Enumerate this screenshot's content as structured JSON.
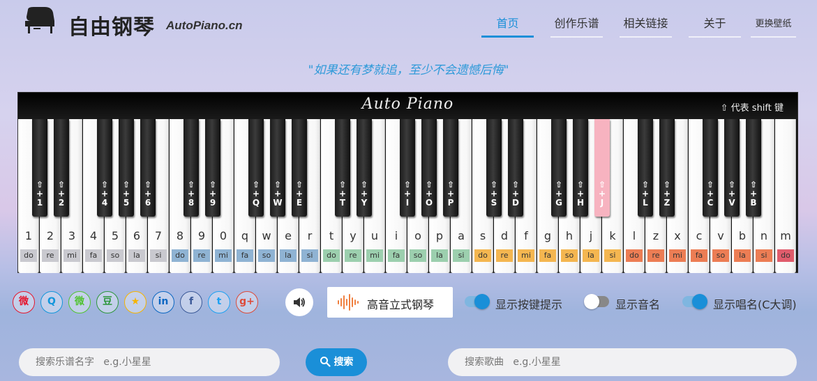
{
  "header": {
    "site_name": "自由钢琴",
    "site_domain": "AutoPiano.cn",
    "nav": [
      {
        "label": "首页"
      },
      {
        "label": "创作乐谱"
      },
      {
        "label": "相关链接"
      },
      {
        "label": "关于"
      },
      {
        "label": "更换壁纸"
      }
    ]
  },
  "slogan": "\"如果还有梦就追，至少不会遗憾后悔\"",
  "piano": {
    "brand": "Auto Piano",
    "shift_note": "⇧ 代表 shift 键",
    "white_keys": [
      {
        "key": "1",
        "solfege": "do",
        "color": "#c9c9cf"
      },
      {
        "key": "2",
        "solfege": "re",
        "color": "#c9c9cf"
      },
      {
        "key": "3",
        "solfege": "mi",
        "color": "#c9c9cf"
      },
      {
        "key": "4",
        "solfege": "fa",
        "color": "#c9c9cf"
      },
      {
        "key": "5",
        "solfege": "so",
        "color": "#c9c9cf"
      },
      {
        "key": "6",
        "solfege": "la",
        "color": "#c9c9cf"
      },
      {
        "key": "7",
        "solfege": "si",
        "color": "#c9c9cf"
      },
      {
        "key": "8",
        "solfege": "do",
        "color": "#8fb3d3"
      },
      {
        "key": "9",
        "solfege": "re",
        "color": "#8fb3d3"
      },
      {
        "key": "0",
        "solfege": "mi",
        "color": "#8fb3d3"
      },
      {
        "key": "q",
        "solfege": "fa",
        "color": "#8fb3d3"
      },
      {
        "key": "w",
        "solfege": "so",
        "color": "#8fb3d3"
      },
      {
        "key": "e",
        "solfege": "la",
        "color": "#8fb3d3"
      },
      {
        "key": "r",
        "solfege": "si",
        "color": "#8fb3d3"
      },
      {
        "key": "t",
        "solfege": "do",
        "color": "#9ccfae"
      },
      {
        "key": "y",
        "solfege": "re",
        "color": "#9ccfae"
      },
      {
        "key": "u",
        "solfege": "mi",
        "color": "#9ccfae"
      },
      {
        "key": "i",
        "solfege": "fa",
        "color": "#9ccfae"
      },
      {
        "key": "o",
        "solfege": "so",
        "color": "#9ccfae"
      },
      {
        "key": "p",
        "solfege": "la",
        "color": "#9ccfae"
      },
      {
        "key": "a",
        "solfege": "si",
        "color": "#9ccfae"
      },
      {
        "key": "s",
        "solfege": "do",
        "color": "#f4b650"
      },
      {
        "key": "d",
        "solfege": "re",
        "color": "#f4b650"
      },
      {
        "key": "f",
        "solfege": "mi",
        "color": "#f4b650"
      },
      {
        "key": "g",
        "solfege": "fa",
        "color": "#f4b650"
      },
      {
        "key": "h",
        "solfege": "so",
        "color": "#f4b650"
      },
      {
        "key": "j",
        "solfege": "la",
        "color": "#f4b650"
      },
      {
        "key": "k",
        "solfege": "si",
        "color": "#f4b650"
      },
      {
        "key": "l",
        "solfege": "do",
        "color": "#ec7d54"
      },
      {
        "key": "z",
        "solfege": "re",
        "color": "#ec7d54"
      },
      {
        "key": "x",
        "solfege": "mi",
        "color": "#ec7d54"
      },
      {
        "key": "c",
        "solfege": "fa",
        "color": "#ec7d54"
      },
      {
        "key": "v",
        "solfege": "so",
        "color": "#ec7d54"
      },
      {
        "key": "b",
        "solfege": "la",
        "color": "#ec7d54"
      },
      {
        "key": "n",
        "solfege": "si",
        "color": "#ec7d54"
      },
      {
        "key": "m",
        "solfege": "do",
        "color": "#e05c6c"
      }
    ],
    "black_keys": [
      {
        "label": "1",
        "active": false
      },
      {
        "label": "2",
        "active": false
      },
      {
        "label": "4",
        "active": false
      },
      {
        "label": "5",
        "active": false
      },
      {
        "label": "6",
        "active": false
      },
      {
        "label": "8",
        "active": false
      },
      {
        "label": "9",
        "active": false
      },
      {
        "label": "Q",
        "active": false
      },
      {
        "label": "W",
        "active": false
      },
      {
        "label": "E",
        "active": false
      },
      {
        "label": "T",
        "active": false
      },
      {
        "label": "Y",
        "active": false
      },
      {
        "label": "I",
        "active": false
      },
      {
        "label": "O",
        "active": false
      },
      {
        "label": "P",
        "active": false
      },
      {
        "label": "S",
        "active": false
      },
      {
        "label": "D",
        "active": false
      },
      {
        "label": "G",
        "active": false
      },
      {
        "label": "H",
        "active": false
      },
      {
        "label": "J",
        "active": true
      },
      {
        "label": "L",
        "active": false
      },
      {
        "label": "Z",
        "active": false
      },
      {
        "label": "C",
        "active": false
      },
      {
        "label": "V",
        "active": false
      },
      {
        "label": "B",
        "active": false
      }
    ]
  },
  "social": [
    {
      "icon": "weibo-icon",
      "glyph": "微",
      "color": "#e6162d"
    },
    {
      "icon": "qq-icon",
      "glyph": "Q",
      "color": "#1296db"
    },
    {
      "icon": "wechat-icon",
      "glyph": "微",
      "color": "#51c332"
    },
    {
      "icon": "douban-icon",
      "glyph": "豆",
      "color": "#2e963d"
    },
    {
      "icon": "qzone-icon",
      "glyph": "★",
      "color": "#f6b400"
    },
    {
      "icon": "linkedin-icon",
      "glyph": "in",
      "color": "#0a66c2"
    },
    {
      "icon": "facebook-icon",
      "glyph": "f",
      "color": "#3b5998"
    },
    {
      "icon": "twitter-icon",
      "glyph": "t",
      "color": "#1da1f2"
    },
    {
      "icon": "googleplus-icon",
      "glyph": "g+",
      "color": "#dd4b39"
    }
  ],
  "instrument": {
    "label": "高音立式钢琴",
    "accent": "#f08040"
  },
  "toggles": [
    {
      "label": "显示按键提示",
      "on": true
    },
    {
      "label": "显示音名",
      "on": false
    },
    {
      "label": "显示唱名(C大调)",
      "on": true
    }
  ],
  "search": {
    "score_placeholder": "搜索乐谱名字   e.g.小星星",
    "button_label": "搜索",
    "song_placeholder": "搜索歌曲   e.g.小星星"
  }
}
